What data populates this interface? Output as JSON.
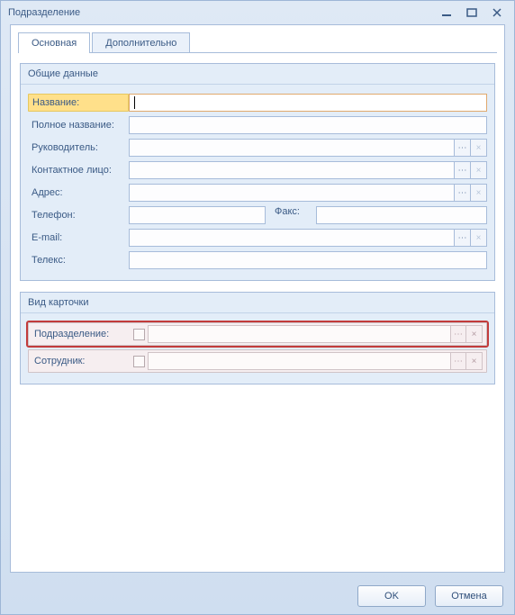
{
  "window": {
    "title": "Подразделение"
  },
  "tabs": {
    "main": "Основная",
    "extra": "Дополнительно"
  },
  "group_general": {
    "title": "Общие данные",
    "name_label": "Название:",
    "fullname_label": "Полное название:",
    "manager_label": "Руководитель:",
    "contact_label": "Контактное лицо:",
    "address_label": "Адрес:",
    "phone_label": "Телефон:",
    "fax_label": "Факс:",
    "email_label": "E-mail:",
    "telex_label": "Телекс:",
    "name_value": "",
    "fullname_value": "",
    "manager_value": "",
    "contact_value": "",
    "address_value": "",
    "phone_value": "",
    "fax_value": "",
    "email_value": "",
    "telex_value": ""
  },
  "group_card": {
    "title": "Вид карточки",
    "department_label": "Подразделение:",
    "employee_label": "Сотрудник:",
    "department_value": "",
    "employee_value": ""
  },
  "buttons": {
    "ok": "OK",
    "cancel": "Отмена"
  },
  "glyphs": {
    "ellipsis": "⋯",
    "clear": "×"
  }
}
